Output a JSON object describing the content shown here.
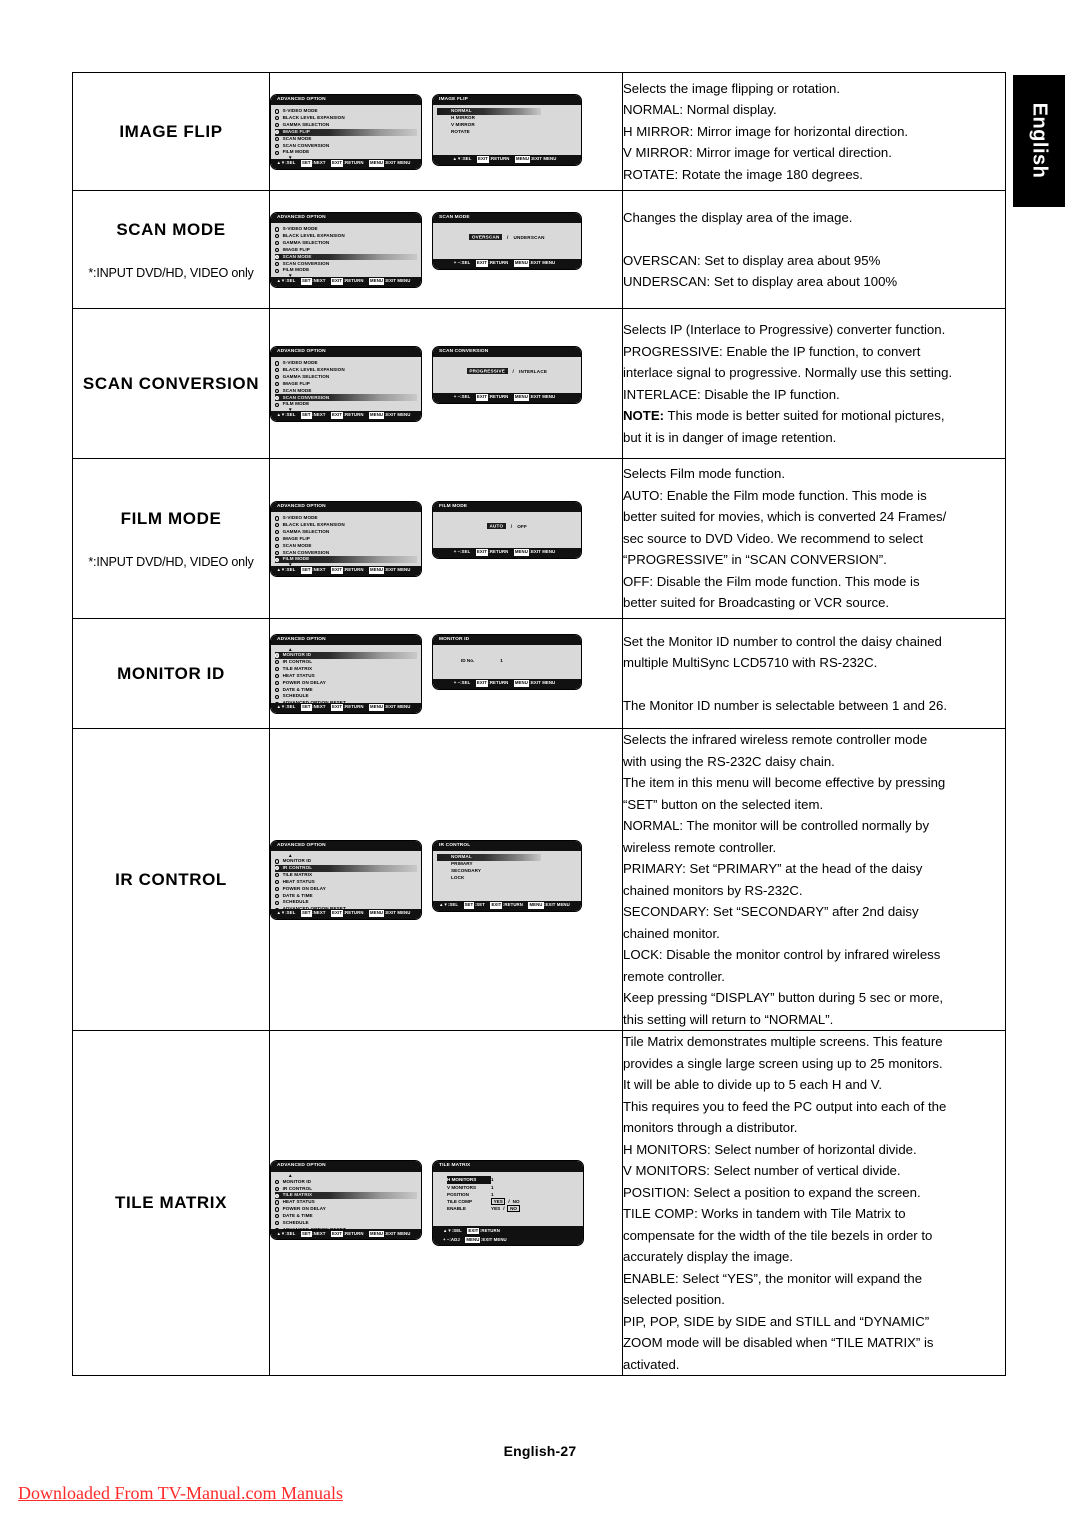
{
  "page": {
    "language_tab": "English",
    "page_number": "English-27",
    "watermark": "Downloaded From TV-Manual.com Manuals"
  },
  "osd_common": {
    "advanced_option_title": "ADVANCED OPTION",
    "footer_main": [
      {
        "keys": "▲▼",
        "label": ":SEL"
      },
      {
        "keys": "SET",
        "label": ":NEXT"
      },
      {
        "keys": "EXIT",
        "label": ":RETURN"
      },
      {
        "keys": "MENU",
        "label": ":EXIT MENU"
      }
    ],
    "footer_sel_set": [
      {
        "keys": "▲▼",
        "label": ":SEL"
      },
      {
        "keys": "SET",
        "label": ":SET"
      },
      {
        "keys": "EXIT",
        "label": ":RETURN"
      },
      {
        "keys": "MENU",
        "label": ":EXIT MENU"
      }
    ],
    "footer_updown": [
      {
        "keys": "▲▼",
        "label": ":SEL"
      },
      {
        "keys": "EXIT",
        "label": ":RETURN"
      },
      {
        "keys": "MENU",
        "label": ":EXIT MENU"
      }
    ],
    "footer_plusminus": [
      {
        "keys": "+ –",
        "label": ":SEL"
      },
      {
        "keys": "EXIT",
        "label": ":RETURN"
      },
      {
        "keys": "MENU",
        "label": ":EXIT MENU"
      }
    ],
    "menu_page1": [
      "S-VIDEO MODE",
      "BLACK LEVEL EXPANSION",
      "GAMMA SELECTION",
      "IMAGE FLIP",
      "SCAN MODE",
      "SCAN CONVERSION",
      "FILM MODE"
    ],
    "menu_page2": [
      "MONITOR ID",
      "IR CONTROL",
      "TILE MATRIX",
      "HEAT STATUS",
      "POWER ON DELAY",
      "DATE & TIME",
      "SCHEDULE",
      "ADVANCED OPTION RESET"
    ]
  },
  "rows": [
    {
      "name": "IMAGE FLIP",
      "note": "",
      "submenu": {
        "title": "IMAGE FLIP",
        "type": "list",
        "items": [
          "NORMAL",
          "H MIRROR",
          "V MIRROR",
          "ROTATE"
        ],
        "selected_index": 0
      },
      "desc": [
        {
          "text": "Selects the image flipping or rotation."
        },
        {
          "text": "NORMAL: Normal display."
        },
        {
          "text": "H MIRROR: Mirror image for horizontal direction."
        },
        {
          "text": "V MIRROR: Mirror image for vertical direction."
        },
        {
          "text": "ROTATE: Rotate the image 180 degrees."
        }
      ]
    },
    {
      "name": "SCAN MODE",
      "note": "*:INPUT DVD/HD, VIDEO only",
      "submenu": {
        "title": "SCAN MODE",
        "type": "choice",
        "options": [
          "OVERSCAN",
          "UNDERSCAN"
        ],
        "selected_index": 0
      },
      "desc": [
        {
          "text": "Changes the display area of the image."
        },
        {
          "text": ""
        },
        {
          "text": "OVERSCAN: Set to display area about 95%"
        },
        {
          "text": "UNDERSCAN: Set to display area about 100%"
        }
      ]
    },
    {
      "name": "SCAN CONVERSION",
      "note": "",
      "submenu": {
        "title": "SCAN CONVERSION",
        "type": "choice",
        "options": [
          "PROGRESSIVE",
          "INTERLACE"
        ],
        "selected_index": 0
      },
      "desc": [
        {
          "text": "Selects IP (Interlace to Progressive) converter function."
        },
        {
          "text": "PROGRESSIVE: Enable the IP function, to convert"
        },
        {
          "text": "interlace signal to progressive. Normally use this setting."
        },
        {
          "text": "INTERLACE: Disable the IP function."
        },
        {
          "bold_prefix": "NOTE:",
          "text": " This mode is better suited for motional pictures,"
        },
        {
          "text": "but it is in danger of image retention."
        }
      ]
    },
    {
      "name": "FILM MODE",
      "note": "*:INPUT DVD/HD, VIDEO only",
      "submenu": {
        "title": "FILM MODE",
        "type": "choice",
        "options": [
          "AUTO",
          "OFF"
        ],
        "selected_index": 0
      },
      "desc": [
        {
          "text": "Selects Film mode function."
        },
        {
          "text": "AUTO: Enable the Film mode function. This mode is"
        },
        {
          "text": "better suited for movies, which is converted 24 Frames/"
        },
        {
          "text": "sec source to DVD Video. We recommend to select"
        },
        {
          "text": "“PROGRESSIVE” in “SCAN CONVERSION”."
        },
        {
          "text": "OFF: Disable the Film mode function. This mode is"
        },
        {
          "text": "better suited for Broadcasting or VCR source."
        }
      ]
    },
    {
      "name": "MONITOR  ID",
      "note": "",
      "submenu": {
        "title": "MONITOR ID",
        "type": "idno",
        "label": "ID No.",
        "value": "1"
      },
      "desc": [
        {
          "text": "Set the Monitor ID number to control the daisy chained"
        },
        {
          "text": "multiple MultiSync LCD5710 with RS-232C."
        },
        {
          "text": ""
        },
        {
          "text": "The Monitor ID number is selectable between 1 and 26."
        }
      ]
    },
    {
      "name": "IR CONTROL",
      "note": "",
      "submenu": {
        "title": "IR CONTROL",
        "type": "list",
        "items": [
          "NORMAL",
          "PRIMARY",
          "SECONDARY",
          "LOCK"
        ],
        "selected_index": 0
      },
      "desc": [
        {
          "text": "Selects the infrared wireless remote controller mode"
        },
        {
          "text": "with using the RS-232C daisy chain."
        },
        {
          "text": "The item in this menu will become effective by pressing"
        },
        {
          "text": "“SET” button on the selected item."
        },
        {
          "text": "NORMAL: The monitor will be controlled normally by"
        },
        {
          "text": "wireless remote controller."
        },
        {
          "text": "PRIMARY: Set “PRIMARY” at the head of the daisy"
        },
        {
          "text": "chained monitors by RS-232C."
        },
        {
          "text": "SECONDARY: Set “SECONDARY” after 2nd daisy"
        },
        {
          "text": "chained monitor."
        },
        {
          "text": "LOCK: Disable the monitor control by infrared wireless"
        },
        {
          "text": "remote controller."
        },
        {
          "text": "Keep pressing “DISPLAY” button during 5 sec or more,"
        },
        {
          "text": "this setting will return to “NORMAL”."
        }
      ]
    },
    {
      "name": "TILE MATRIX",
      "note": "",
      "submenu": {
        "title": "TILE MATRIX",
        "type": "tile",
        "rows": [
          {
            "name": "H  MONITORS",
            "value": "1",
            "highlight": true
          },
          {
            "name": "V  MONITORS",
            "value": "1",
            "highlight": false
          },
          {
            "name": "POSITION",
            "value": "1",
            "highlight": false
          },
          {
            "name": "TILE COMP",
            "yes": "YES",
            "no": "NO",
            "boxed": "yes"
          },
          {
            "name": "ENABLE",
            "yes": "YES",
            "no": "NO",
            "boxed": "no"
          }
        ],
        "footer_lines": [
          [
            {
              "keys": "▲▼",
              "label": ":SEL"
            },
            {
              "keys": "EXIT",
              "label": ":RETURN"
            }
          ],
          [
            {
              "keys": "+ –",
              "label": ":ADJ"
            },
            {
              "keys": "MENU",
              "label": ":EXIT MENU"
            }
          ]
        ]
      },
      "desc": [
        {
          "text": "Tile Matrix demonstrates multiple screens. This feature"
        },
        {
          "text": "provides a single large screen using up to 25 monitors."
        },
        {
          "text": "It will be able to divide up to 5 each H and V."
        },
        {
          "text": "This requires you to feed the PC output into each of the"
        },
        {
          "text": "monitors through a distributor."
        },
        {
          "text": "H MONITORS: Select number of horizontal divide."
        },
        {
          "text": "V MONITORS: Select number of vertical divide."
        },
        {
          "text": "POSITION: Select a position to expand the screen."
        },
        {
          "text": "TILE COMP: Works in tandem with Tile Matrix to"
        },
        {
          "text": "compensate for the width of the tile bezels in order to"
        },
        {
          "text": "accurately display the image."
        },
        {
          "text": "ENABLE: Select “YES”, the monitor will expand the"
        },
        {
          "text": "selected position."
        },
        {
          "text": "PIP, POP, SIDE by SIDE and STILL and “DYNAMIC”"
        },
        {
          "text": "ZOOM mode will be disabled when “TILE MATRIX” is"
        },
        {
          "text": "activated."
        }
      ]
    }
  ]
}
